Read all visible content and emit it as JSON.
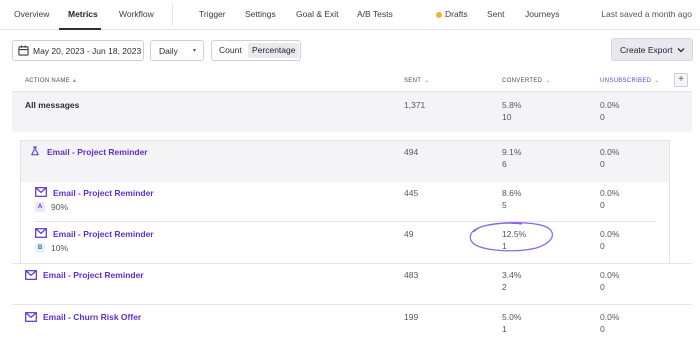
{
  "nav": {
    "tabs": [
      "Overview",
      "Metrics",
      "Workflow",
      "Trigger",
      "Settings",
      "Goal & Exit",
      "A/B Tests",
      "Drafts",
      "Sent",
      "Journeys"
    ],
    "active_tab": "Metrics",
    "saved_text": "Last saved a month ago"
  },
  "toolbar": {
    "date_range": "May 20, 2023 - Jun 18, 2023",
    "interval": "Daily",
    "toggle_count": "Count",
    "toggle_percentage": "Percentage",
    "export_label": "Create Export"
  },
  "table": {
    "headers": {
      "action_name": "ACTION NAME",
      "sent": "SENT",
      "converted": "CONVERTED",
      "unsubscribed": "UNSUBSCRIBED"
    },
    "rows": [
      {
        "name": "All messages",
        "icon": "none",
        "sent": "1,371",
        "conv_pct": "5.8%",
        "conv_count": "10",
        "unsub_pct": "0.0%",
        "unsub_count": "0"
      },
      {
        "name": "Email - Project Reminder",
        "icon": "flask-icon",
        "sent": "494",
        "conv_pct": "9.1%",
        "conv_count": "6",
        "unsub_pct": "0.0%",
        "unsub_count": "0"
      },
      {
        "name": "Email - Project Reminder",
        "icon": "envelope-icon",
        "variant": "A",
        "variant_pct": "90%",
        "sent": "445",
        "conv_pct": "8.6%",
        "conv_count": "5",
        "unsub_pct": "0.0%",
        "unsub_count": "0"
      },
      {
        "name": "Email - Project Reminder",
        "icon": "envelope-icon",
        "variant": "B",
        "variant_pct": "10%",
        "sent": "49",
        "conv_pct": "12.5%",
        "conv_count": "1",
        "unsub_pct": "0.0%",
        "unsub_count": "0"
      },
      {
        "name": "Email - Project Reminder",
        "icon": "envelope-icon",
        "sent": "483",
        "conv_pct": "3.4%",
        "conv_count": "2",
        "unsub_pct": "0.0%",
        "unsub_count": "0"
      },
      {
        "name": "Email - Churn Risk Offer",
        "icon": "envelope-icon",
        "sent": "199",
        "conv_pct": "5.0%",
        "conv_count": "1",
        "unsub_pct": "0.0%",
        "unsub_count": "0"
      }
    ]
  },
  "colors": {
    "accent": "#5a2fd0",
    "drafts_dot": "#f6b32b",
    "annotation": "#8a63e6"
  }
}
